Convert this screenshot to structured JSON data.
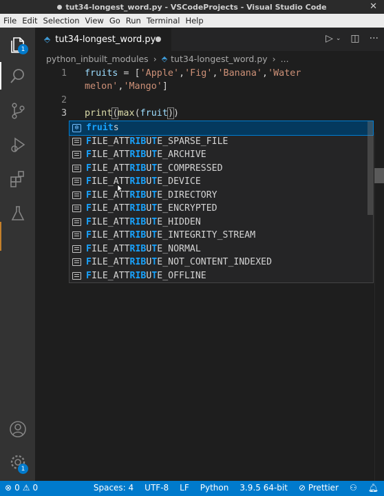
{
  "window": {
    "title": "tut34-longest_word.py - VSCodeProjects - Visual Studio Code",
    "close_icon": "✕"
  },
  "menu": [
    "File",
    "Edit",
    "Selection",
    "View",
    "Go",
    "Run",
    "Terminal",
    "Help"
  ],
  "activity": {
    "explorer_badge": "1",
    "manage_badge": "1"
  },
  "tab": {
    "label": "tut34-longest_word.py"
  },
  "breadcrumb": {
    "folder": "python_inbuilt_modules",
    "file": "tut34-longest_word.py",
    "more": "..."
  },
  "editor": {
    "line_numbers": [
      "1",
      "2",
      "3"
    ],
    "line1a": [
      "fruits",
      " = [",
      "'Apple'",
      ",",
      "'Fig'",
      ",",
      "'Banana'",
      ",",
      "'Water"
    ],
    "line1b": [
      "melon'",
      ",",
      "'Mango'",
      "]"
    ],
    "line3": [
      "print",
      "(",
      "max",
      "(",
      "fruit",
      ")",
      ")"
    ]
  },
  "suggestions": [
    {
      "kind": "variable",
      "hl": "fruit",
      "rest": "s",
      "selected": true
    },
    {
      "kind": "constant",
      "label": "FILE_ATTRIBUTE_SPARSE_FILE"
    },
    {
      "kind": "constant",
      "label": "FILE_ATTRIBUTE_ARCHIVE"
    },
    {
      "kind": "constant",
      "label": "FILE_ATTRIBUTE_COMPRESSED"
    },
    {
      "kind": "constant",
      "label": "FILE_ATTRIBUTE_DEVICE"
    },
    {
      "kind": "constant",
      "label": "FILE_ATTRIBUTE_DIRECTORY"
    },
    {
      "kind": "constant",
      "label": "FILE_ATTRIBUTE_ENCRYPTED"
    },
    {
      "kind": "constant",
      "label": "FILE_ATTRIBUTE_HIDDEN"
    },
    {
      "kind": "constant",
      "label": "FILE_ATTRIBUTE_INTEGRITY_STREAM"
    },
    {
      "kind": "constant",
      "label": "FILE_ATTRIBUTE_NORMAL"
    },
    {
      "kind": "constant",
      "label": "FILE_ATTRIBUTE_NOT_CONTENT_INDEXED"
    },
    {
      "kind": "constant",
      "label": "FILE_ATTRIBUTE_OFFLINE"
    }
  ],
  "status": {
    "errors": "0",
    "warnings": "0",
    "spaces": "Spaces: 4",
    "encoding": "UTF-8",
    "eol": "LF",
    "language": "Python",
    "interpreter": "3.9.5 64-bit",
    "prettier": "Prettier"
  },
  "colors": {
    "accent": "#007acc",
    "match_highlight": "#18a3ff",
    "selected_item": "#04395e"
  }
}
